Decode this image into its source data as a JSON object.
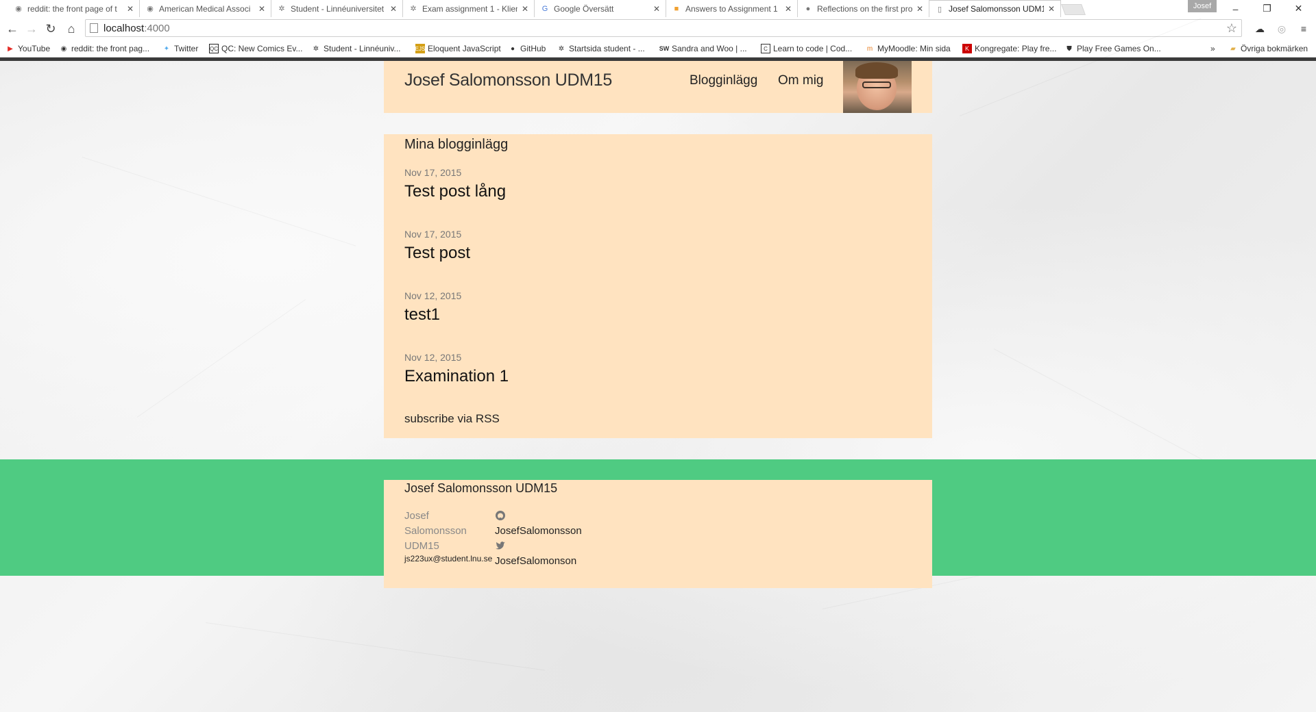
{
  "browser": {
    "tabs": [
      {
        "title": "reddit: the front page of t",
        "icon": "reddit-alien-icon"
      },
      {
        "title": "American Medical Associ",
        "icon": "reddit-alien-icon"
      },
      {
        "title": "Student - Linnéuniversitet",
        "icon": "lnu-tree-icon"
      },
      {
        "title": "Exam assignment 1 - Klien",
        "icon": "lnu-tree-icon"
      },
      {
        "title": "Google Översätt",
        "icon": "google-translate-icon"
      },
      {
        "title": "Answers to Assignment 1",
        "icon": "document-icon"
      },
      {
        "title": "Reflections on the first pro",
        "icon": "github-icon"
      },
      {
        "title": "Josef Salomonsson UDM1",
        "icon": "page-icon"
      }
    ],
    "profile_label": "Josef",
    "address": {
      "host": "localhost",
      "port": ":4000"
    },
    "bookmarks": [
      {
        "label": "YouTube",
        "icon": "youtube-icon",
        "color": "#e52d27"
      },
      {
        "label": "reddit: the front pag...",
        "icon": "reddit-alien-icon",
        "color": "#555555"
      },
      {
        "label": "Twitter",
        "icon": "twitter-bird-icon",
        "color": "#55acee"
      },
      {
        "label": "QC: New Comics Ev...",
        "icon": "qc-icon",
        "color": "#222222"
      },
      {
        "label": "Student - Linnéuniv...",
        "icon": "lnu-tree-icon",
        "color": "#333333"
      },
      {
        "label": "Eloquent JavaScript",
        "icon": "ejs-icon",
        "color": "#d4a017"
      },
      {
        "label": "GitHub",
        "icon": "github-icon",
        "color": "#222222"
      },
      {
        "label": "Startsida student - ...",
        "icon": "lnu-tree-icon",
        "color": "#333333"
      },
      {
        "label": "Sandra and Woo | ...",
        "icon": "sw-icon",
        "color": "#222222"
      },
      {
        "label": "Learn to code | Cod...",
        "icon": "codecademy-icon",
        "color": "#333333"
      },
      {
        "label": "MyMoodle: Min sida",
        "icon": "moodle-icon",
        "color": "#e87f23"
      },
      {
        "label": "Kongregate: Play fre...",
        "icon": "kongregate-icon",
        "color": "#cc0000"
      },
      {
        "label": "Play Free Games On...",
        "icon": "shield-icon",
        "color": "#333333"
      }
    ],
    "bookmarks_overflow": "»",
    "other_bookmarks": "Övriga bokmärken"
  },
  "site": {
    "title": "Josef Salomonsson UDM15",
    "nav": [
      "Blogginlägg",
      "Om mig"
    ],
    "section_title": "Mina blogginlägg",
    "posts": [
      {
        "date": "Nov 17, 2015",
        "title": "Test post lång"
      },
      {
        "date": "Nov 17, 2015",
        "title": "Test post"
      },
      {
        "date": "Nov 12, 2015",
        "title": "test1"
      },
      {
        "date": "Nov 12, 2015",
        "title": "Examination 1"
      }
    ],
    "rss": "subscribe via RSS"
  },
  "footer": {
    "title": "Josef Salomonsson UDM15",
    "name_lines": [
      "Josef",
      "Salomonsson",
      "UDM15"
    ],
    "email": "js223ux@student.lnu.se",
    "github_user": "JosefSalomonsson",
    "twitter_user": "JosefSalomonson"
  },
  "colors": {
    "content_bg": "#ffe3c0",
    "footer_band": "#4fcb82"
  }
}
